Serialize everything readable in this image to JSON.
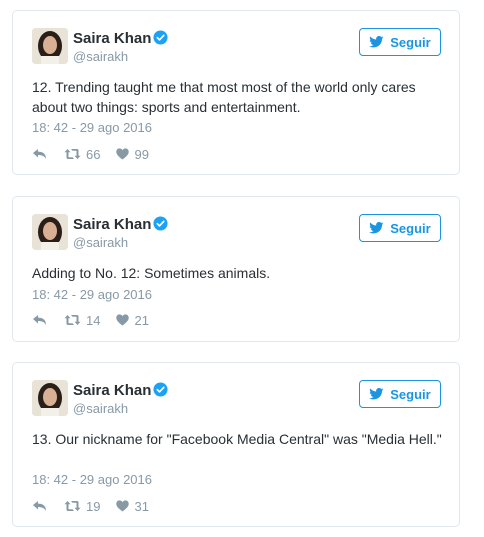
{
  "tweets": [
    {
      "name": "Saira Khan",
      "handle": "@sairakh",
      "follow_label": "Seguir",
      "text": "12. Trending taught me that most most of the world only cares about two things: sports and entertainment.",
      "timestamp": "18: 42 - 29 ago 2016",
      "retweets": "66",
      "likes": "99"
    },
    {
      "name": "Saira Khan",
      "handle": "@sairakh",
      "follow_label": "Seguir",
      "text": "Adding to No. 12: Sometimes animals.",
      "timestamp": "18: 42 - 29 ago 2016",
      "retweets": "14",
      "likes": "21"
    },
    {
      "name": "Saira Khan",
      "handle": "@sairakh",
      "follow_label": "Seguir",
      "text": "13. Our nickname for \"Facebook Media Central\" was \"Media Hell.\"",
      "timestamp": "18: 42 - 29 ago 2016",
      "retweets": "19",
      "likes": "31"
    }
  ],
  "colors": {
    "accent": "#1b95e0",
    "verified": "#1da1f2",
    "muted": "#8899a6",
    "text": "#292f33",
    "border": "#e1e8ed"
  },
  "icons": [
    "verified-badge-icon",
    "twitter-bird-icon",
    "reply-icon",
    "retweet-icon",
    "heart-icon"
  ]
}
